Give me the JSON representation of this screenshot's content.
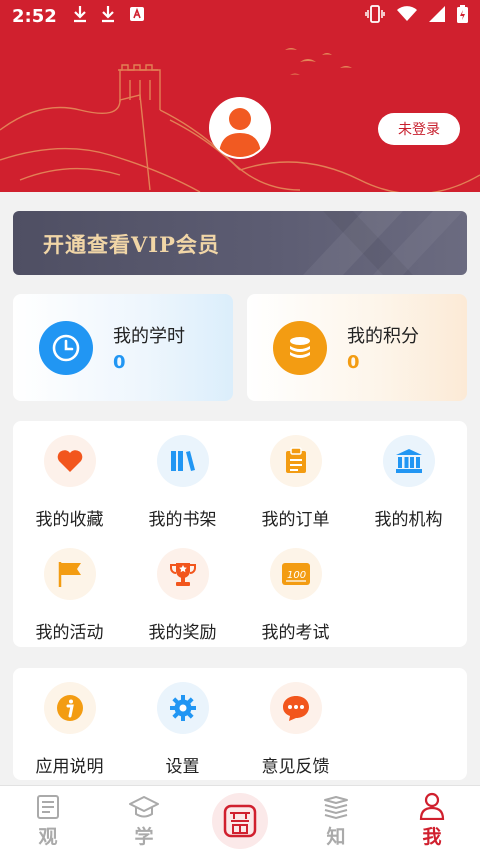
{
  "status_bar": {
    "time": "2:52"
  },
  "header": {
    "login_label": "未登录"
  },
  "vip": {
    "label": "开通查看VIP会员"
  },
  "stats": [
    {
      "label": "我的学时",
      "value": "0",
      "color": "#2196f3"
    },
    {
      "label": "我的积分",
      "value": "0",
      "color": "#f39c12"
    }
  ],
  "menu": {
    "items": [
      {
        "label": "我的收藏",
        "icon": "heart-icon"
      },
      {
        "label": "我的书架",
        "icon": "bookshelf-icon"
      },
      {
        "label": "我的订单",
        "icon": "order-icon"
      },
      {
        "label": "我的机构",
        "icon": "institution-icon"
      },
      {
        "label": "我的活动",
        "icon": "flag-icon"
      },
      {
        "label": "我的奖励",
        "icon": "trophy-icon"
      },
      {
        "label": "我的考试",
        "icon": "exam-icon"
      }
    ]
  },
  "utilities": {
    "items": [
      {
        "label": "应用说明",
        "icon": "info-icon"
      },
      {
        "label": "设置",
        "icon": "gear-icon"
      },
      {
        "label": "意见反馈",
        "icon": "feedback-icon"
      }
    ]
  },
  "bottom_nav": {
    "tabs": [
      {
        "label": "观",
        "icon": "document-icon"
      },
      {
        "label": "学",
        "icon": "graduation-cap-icon"
      },
      {
        "label": "",
        "icon": "seal-logo-icon"
      },
      {
        "label": "知",
        "icon": "books-icon"
      },
      {
        "label": "我",
        "icon": "person-icon"
      }
    ],
    "active_index": 4
  },
  "colors": {
    "brand_red": "#d0202e",
    "blue": "#2196f3",
    "orange": "#f39c12",
    "vip_gold": "#f1d6a7"
  }
}
